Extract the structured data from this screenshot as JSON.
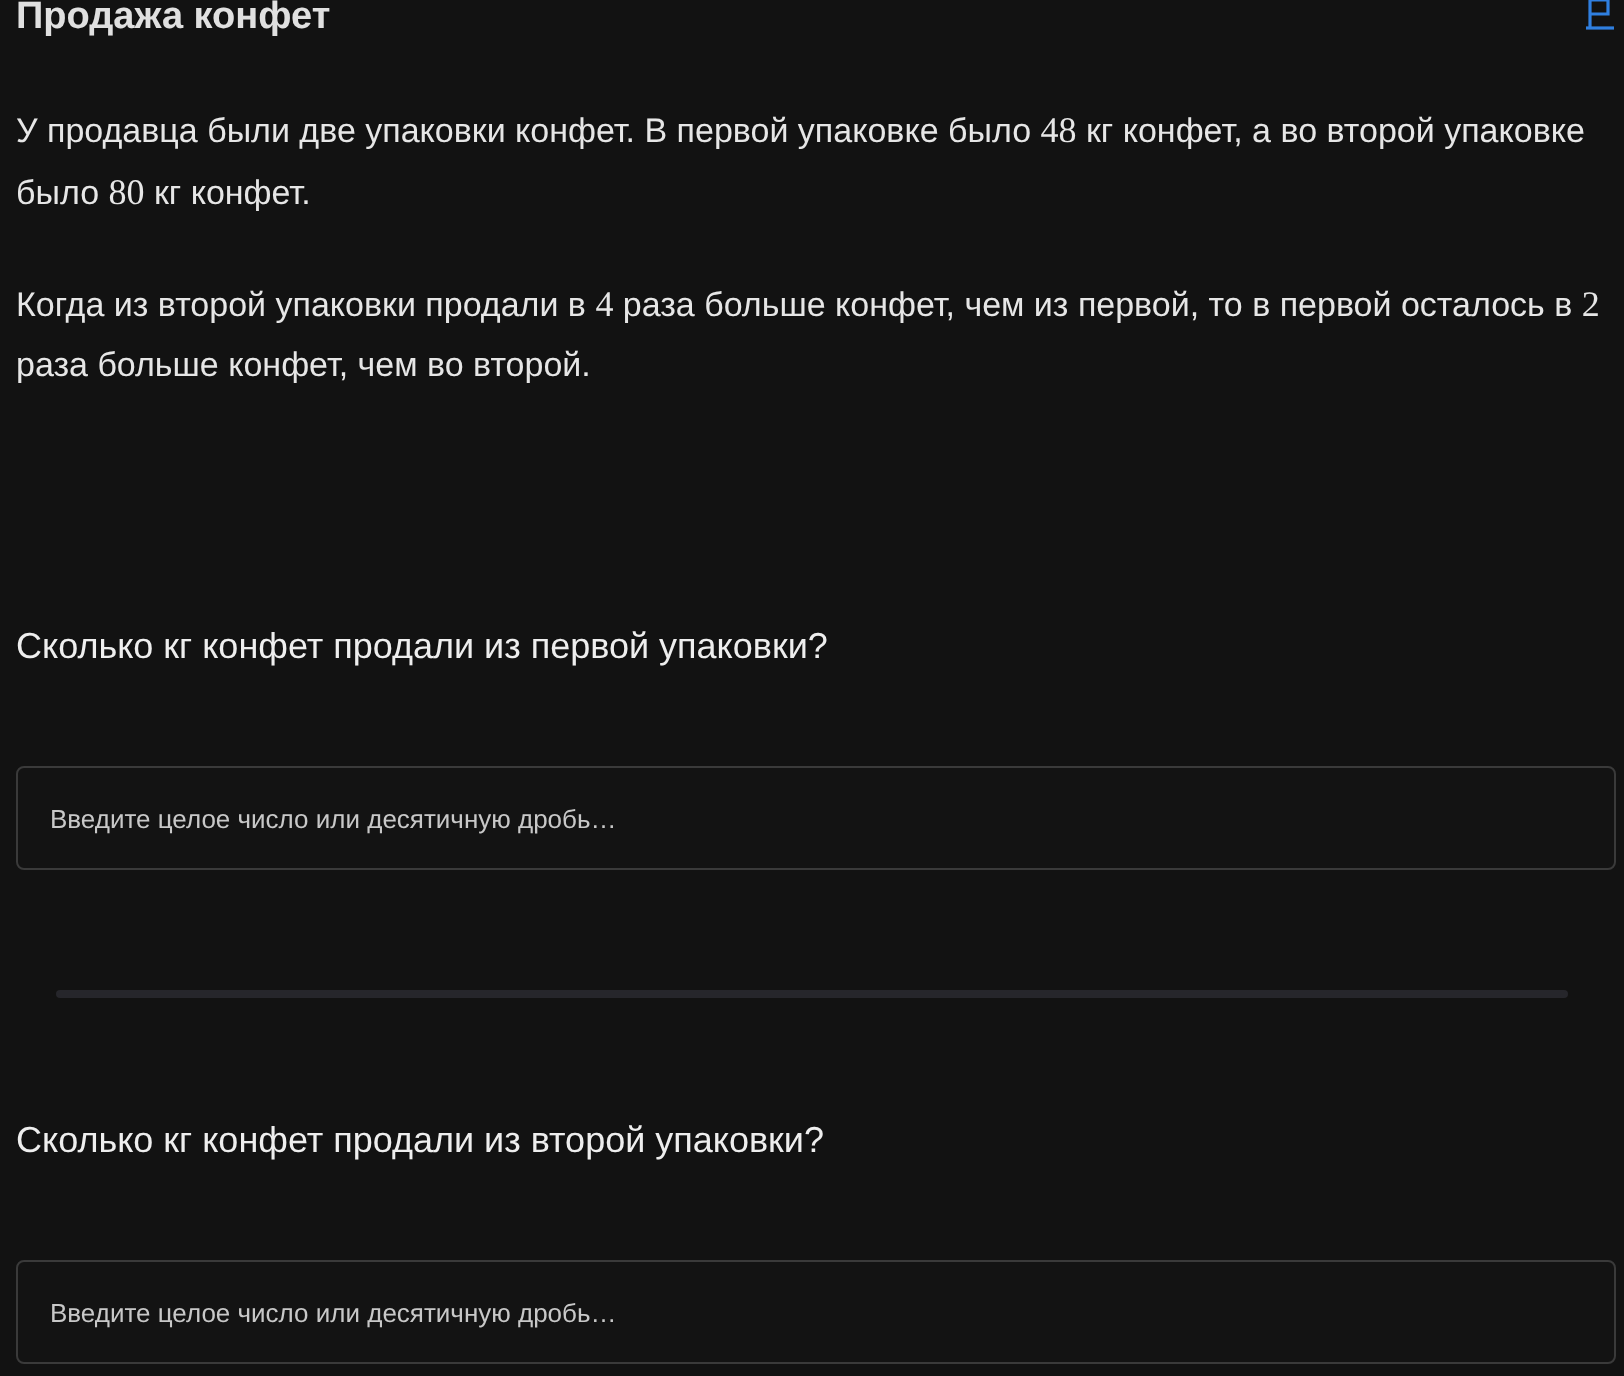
{
  "title": "Продажа конфет",
  "paragraphs": [
    [
      {
        "kind": "text",
        "text": "У продавца были две упаковки конфет. В первой упаковке было "
      },
      {
        "kind": "math",
        "text": "48"
      },
      {
        "kind": "text",
        "text": " кг конфет, а во второй упаковке было "
      },
      {
        "kind": "math",
        "text": "80"
      },
      {
        "kind": "text",
        "text": " кг конфет."
      }
    ],
    [
      {
        "kind": "text",
        "text": "Когда из второй упаковки продали в "
      },
      {
        "kind": "math",
        "text": "4"
      },
      {
        "kind": "text",
        "text": " раза больше конфет, чем из первой, то в первой осталось в "
      },
      {
        "kind": "math",
        "text": "2"
      },
      {
        "kind": "text",
        "text": " раза больше конфет, чем во второй."
      }
    ]
  ],
  "questions": [
    {
      "question": "Сколько кг конфет продали из первой упаковки?",
      "placeholder": "Введите целое число или десятичную дробь…"
    },
    {
      "question": "Сколько кг конфет продали из второй упаковки?",
      "placeholder": "Введите целое число или десятичную дробь…"
    }
  ]
}
